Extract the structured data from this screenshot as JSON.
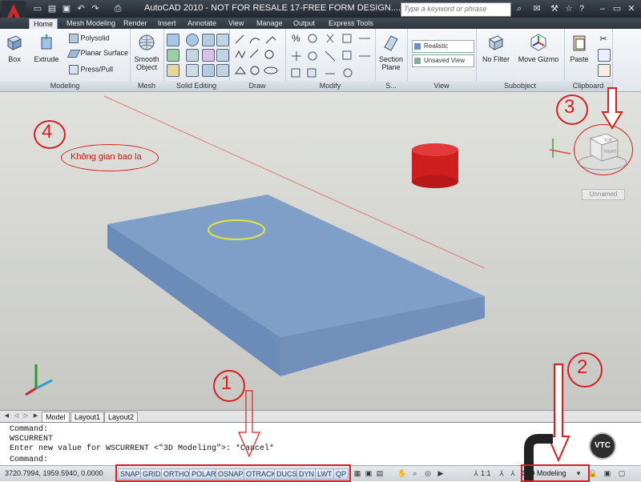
{
  "titlebar": {
    "title": "AutoCAD 2010 - NOT FOR RESALE    17-FREE FORM DESIGN....",
    "search_placeholder": "Type a keyword or phrase"
  },
  "tabs": [
    "Home",
    "Mesh Modeling",
    "Render",
    "Insert",
    "Annotate",
    "View",
    "Manage",
    "Output",
    "Express Tools"
  ],
  "ribbon": {
    "modeling": {
      "box": "Box",
      "extrude": "Extrude",
      "polysolid": "Polysolid",
      "planar_surface": "Planar Surface",
      "presspull": "Press/Pull",
      "title": "Modeling"
    },
    "mesh": {
      "smooth": "Smooth",
      "object": "Object",
      "title": "Mesh"
    },
    "solid_editing_title": "Solid Editing",
    "draw_title": "Draw",
    "modify_title": "Modify",
    "section": {
      "label1": "Section",
      "label2": "Plane",
      "title": "S..."
    },
    "view": {
      "visual_style": "Realistic",
      "saved_view": "Unsaved View",
      "title": "View"
    },
    "subobject": {
      "no_filter": "No Filter",
      "move_gizmo": "Move Gizmo",
      "title": "Subobject"
    },
    "clipboard": {
      "paste": "Paste",
      "title": "Clipboard"
    }
  },
  "viewport": {
    "note": "Không gian bao la",
    "viewcube_top": "TOP",
    "viewcube_right": "RIGHT",
    "ucs_label": "Unnamed"
  },
  "layout_tabs": [
    "Model",
    "Layout1",
    "Layout2"
  ],
  "command": {
    "lines": [
      "Command:",
      "WSCURRENT",
      "Enter new value for WSCURRENT <\"3D Modeling\">: *Cancel*",
      "Command:"
    ]
  },
  "status": {
    "coords": "3720.7994, 1959.5940, 0.0000",
    "toggles": [
      "SNAP",
      "GRID",
      "ORTHO",
      "POLAR",
      "OSNAP",
      "OTRACK",
      "DUCS",
      "DYN",
      "LWT",
      "QP"
    ],
    "scale": "1:1",
    "workspace": "3D Modeling"
  },
  "annotations": [
    "1",
    "2",
    "3",
    "4"
  ],
  "watermark": "VTC",
  "colors": {
    "annotation": "#d92020",
    "slab": "#7f9fc9",
    "cylinder": "#d41e1e",
    "titlebar": "#2a3038"
  }
}
